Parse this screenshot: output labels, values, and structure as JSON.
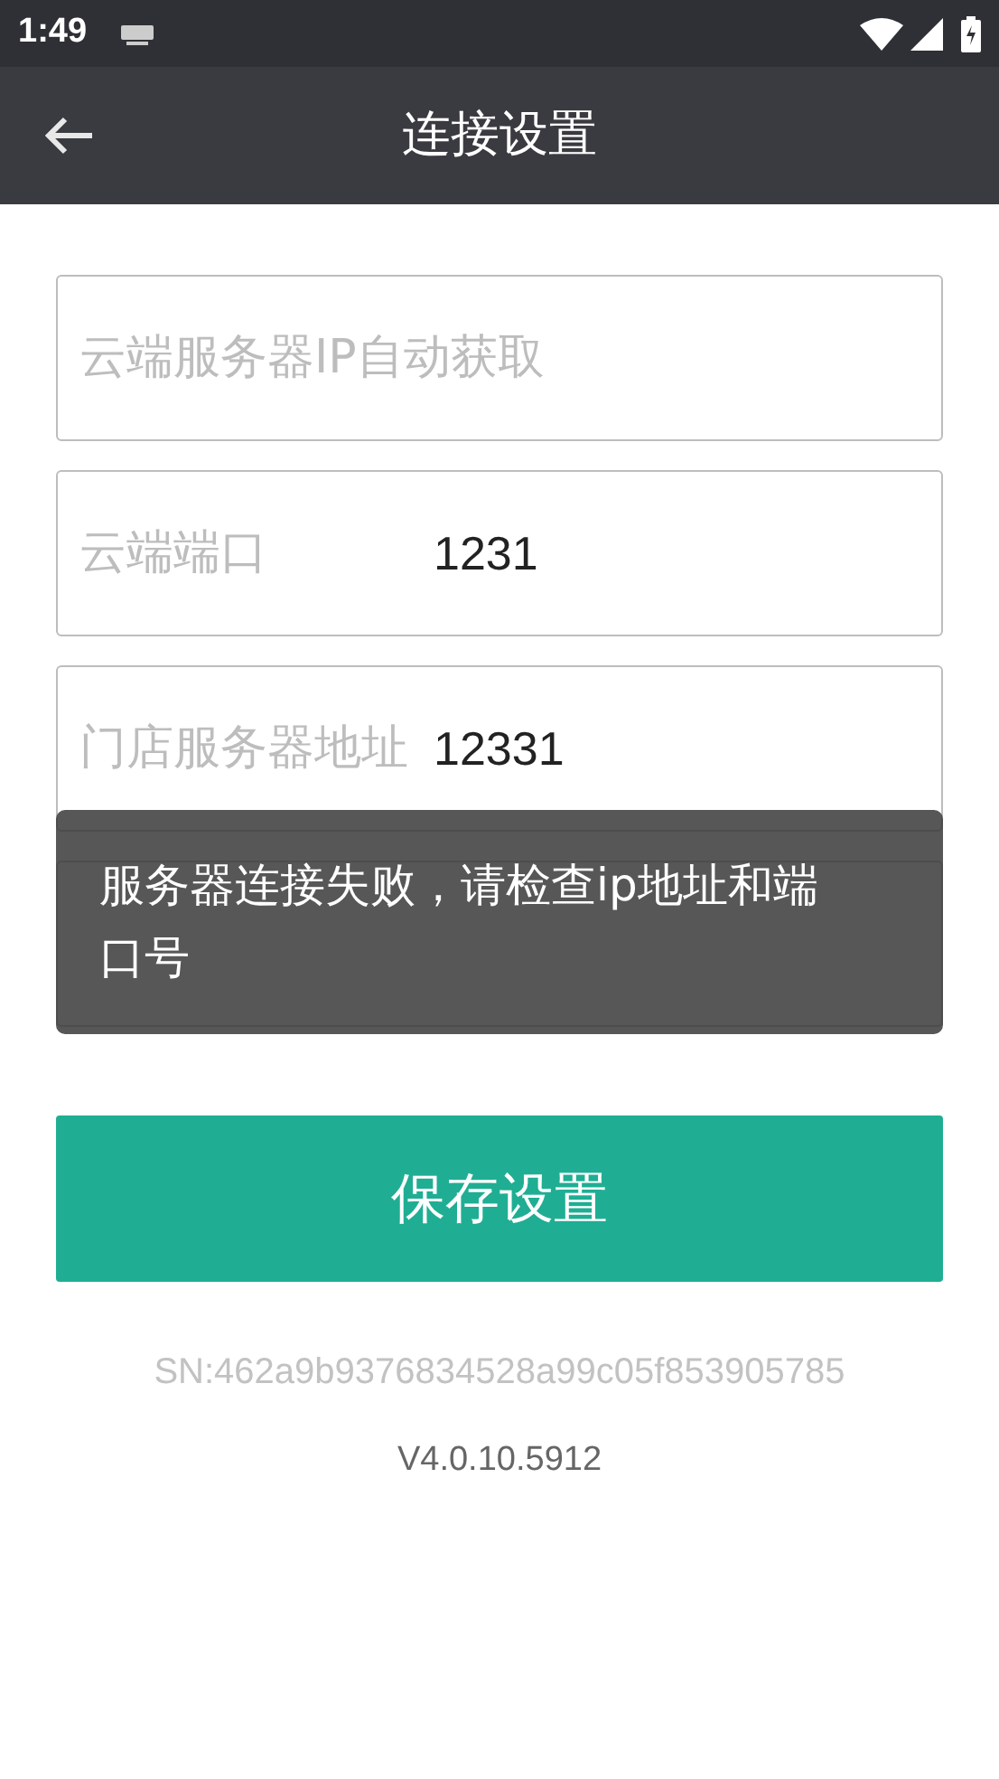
{
  "status_bar": {
    "time": "1:49"
  },
  "app_bar": {
    "title": "连接设置"
  },
  "fields": [
    {
      "kind": "hint",
      "placeholder": "云端服务器IP自动获取"
    },
    {
      "kind": "labeled",
      "label": "云端端口",
      "value": "1231"
    },
    {
      "kind": "labeled",
      "label": "门店服务器地址",
      "value": "12331"
    },
    {
      "kind": "covered"
    }
  ],
  "save_button": "保存设置",
  "serial": "SN:462a9b9376834528a99c05f853905785",
  "version": "V4.0.10.5912",
  "toast": "服务器连接失败，请检查ip地址和端口号"
}
